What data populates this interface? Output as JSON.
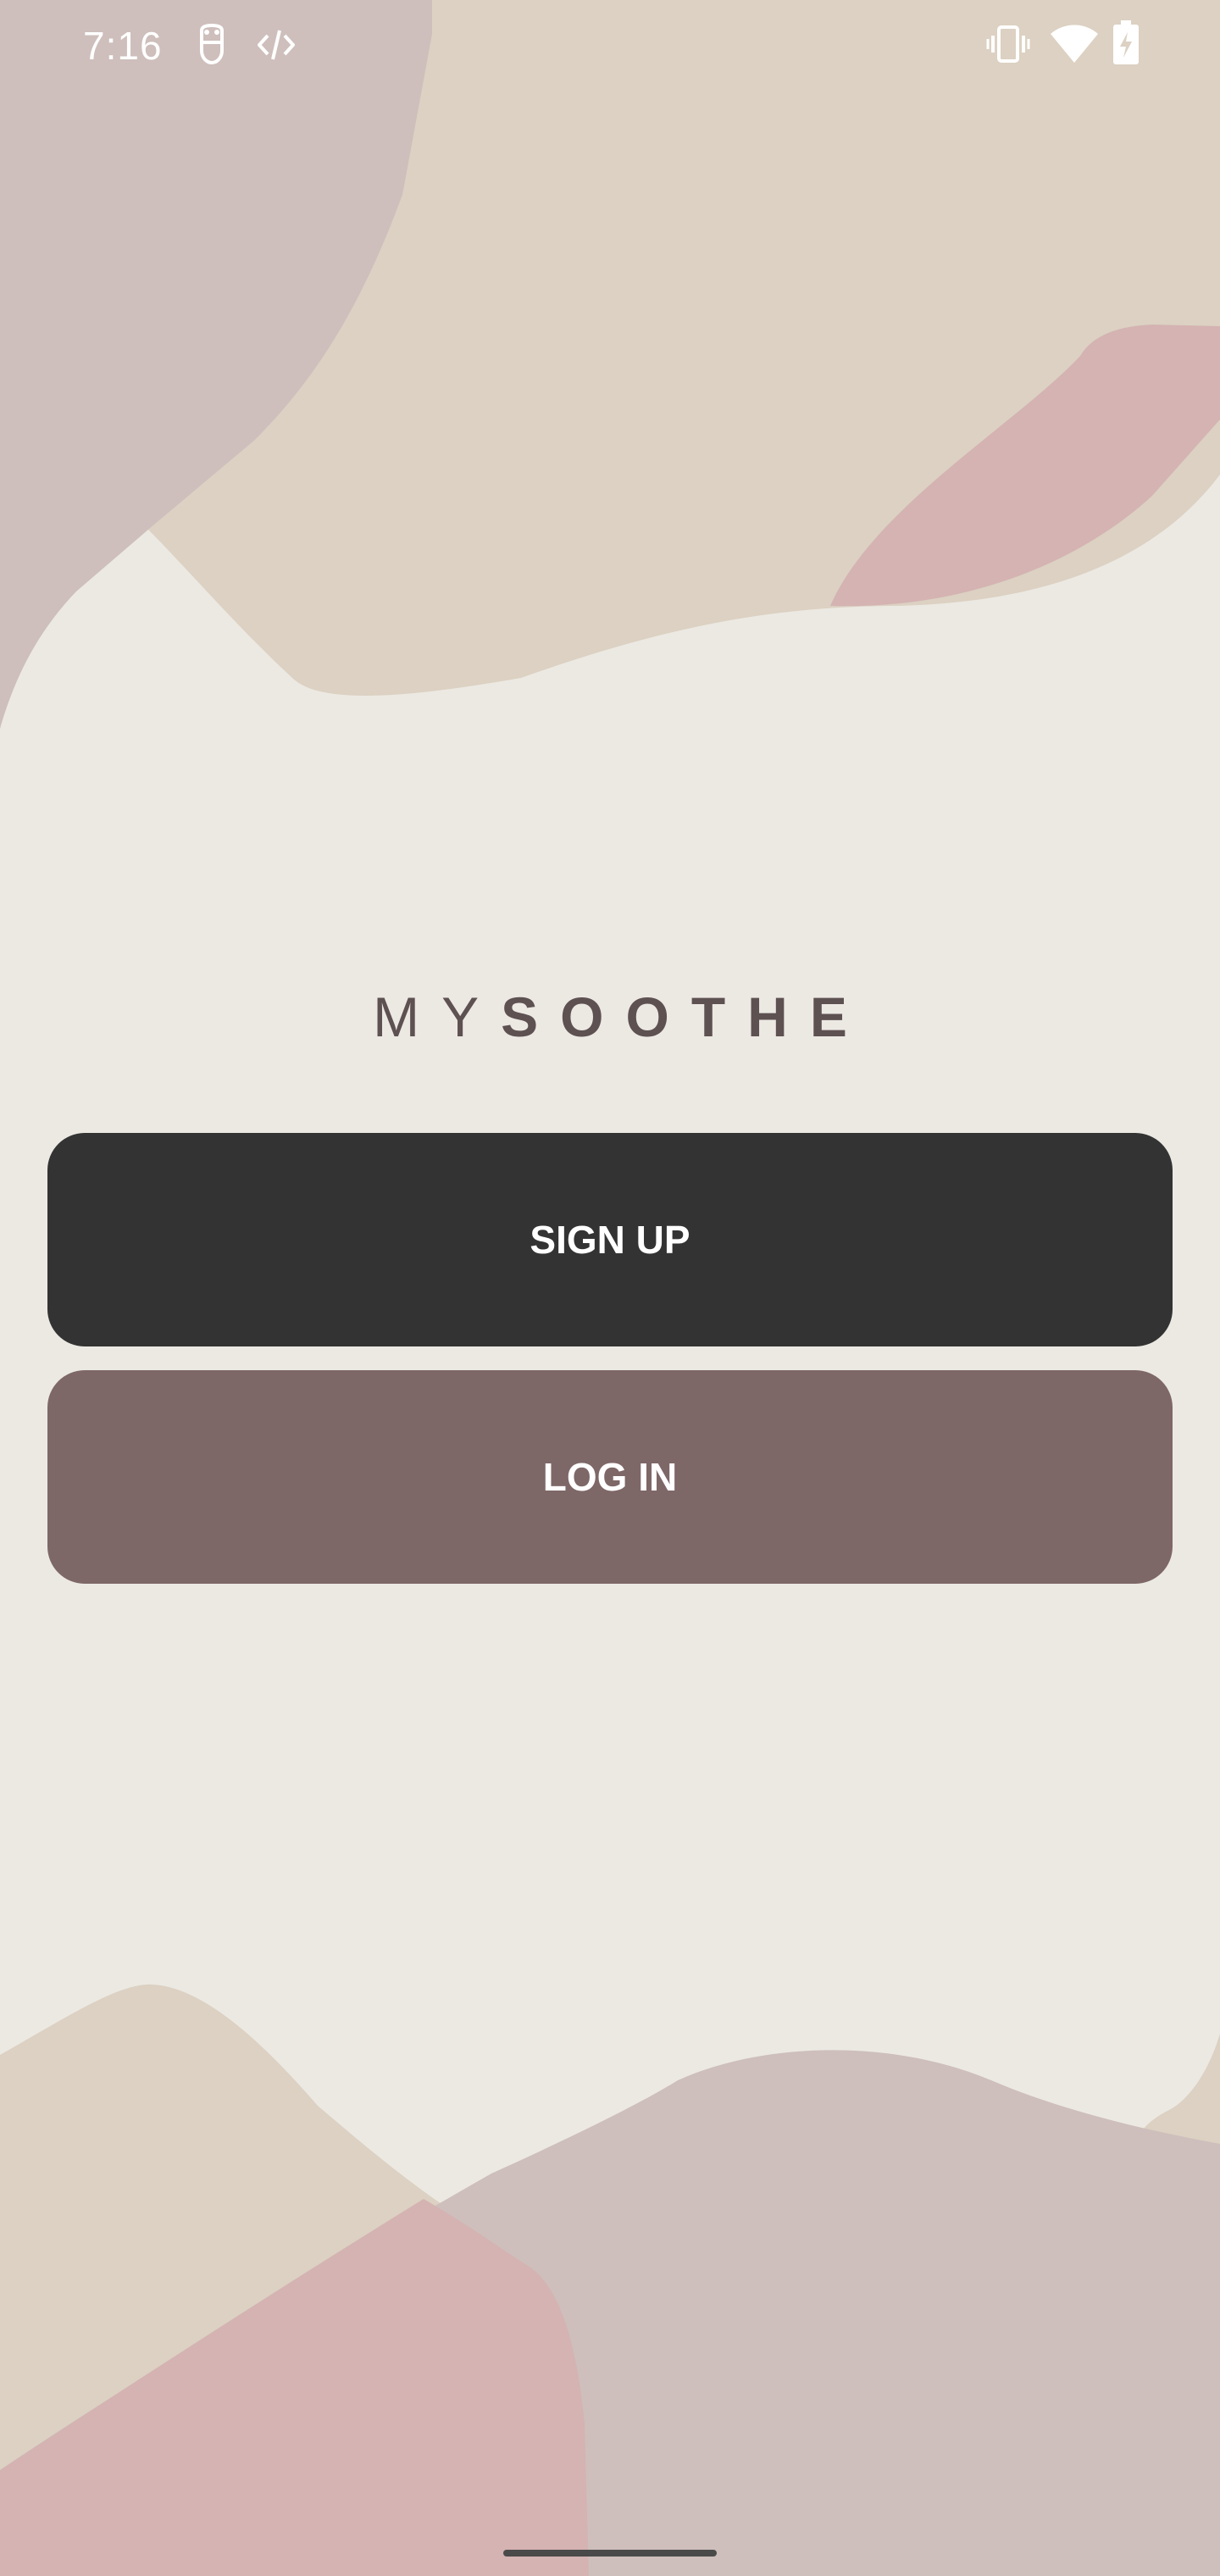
{
  "status_bar": {
    "time": "7:16",
    "notification_icons": [
      "face-notification-icon",
      "code-notification-icon"
    ],
    "system_icons": [
      "vibrate-icon",
      "wifi-icon",
      "battery-charging-icon"
    ]
  },
  "logo": {
    "part1": "MY",
    "part2": "SOOTHE"
  },
  "buttons": {
    "signup_label": "SIGN UP",
    "login_label": "LOG IN"
  },
  "colors": {
    "background": "#ECE9E3",
    "signup_button": "#333333",
    "login_button": "#7E6767",
    "logo_text": "#5E5152",
    "shape_beige": "#DCD1C2",
    "shape_mauve": "#CEBFBC",
    "shape_pink": "#D4B3B2"
  }
}
